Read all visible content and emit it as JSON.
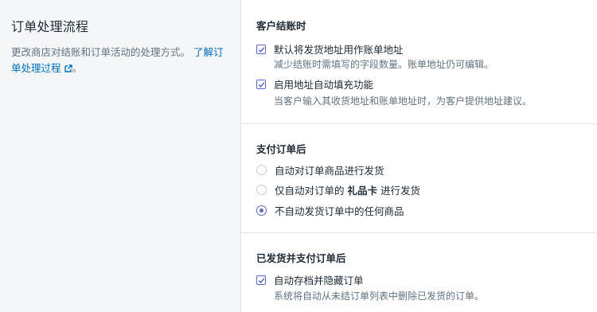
{
  "sidebar": {
    "title": "订单处理流程",
    "description": "更改商店对结账和订单活动的处理方式。",
    "learn_more_link": "了解订单处理过程",
    "period": "。"
  },
  "sections": {
    "checkout": {
      "title": "客户结账时",
      "options": [
        {
          "label": "默认将发货地址用作账单地址",
          "help": "减少结账时需填写的字段数量。账单地址仍可编辑。",
          "checked": true
        },
        {
          "label": "启用地址自动填充功能",
          "help": "当客户输入其收货地址和账单地址时，为客户提供地址建议。",
          "checked": true
        }
      ]
    },
    "after_payment": {
      "title": "支付订单后",
      "options": [
        {
          "label": "自动对订单商品进行发货",
          "checked": false
        },
        {
          "label_pre": "仅自动对订单的",
          "label_bold": "礼品卡",
          "label_post": "进行发货",
          "checked": false
        },
        {
          "label": "不自动发货订单中的任何商品",
          "checked": true
        }
      ]
    },
    "after_fulfilled": {
      "title": "已发货并支付订单后",
      "options": [
        {
          "label": "自动存档并隐藏订单",
          "help": "系统将自动从未结订单列表中删除已发货的订单。",
          "checked": true
        }
      ]
    }
  },
  "colors": {
    "accent": "#5c6ac4",
    "link": "#006fbb",
    "subdued_text": "#637381",
    "page_bg": "#f4f6f8"
  }
}
